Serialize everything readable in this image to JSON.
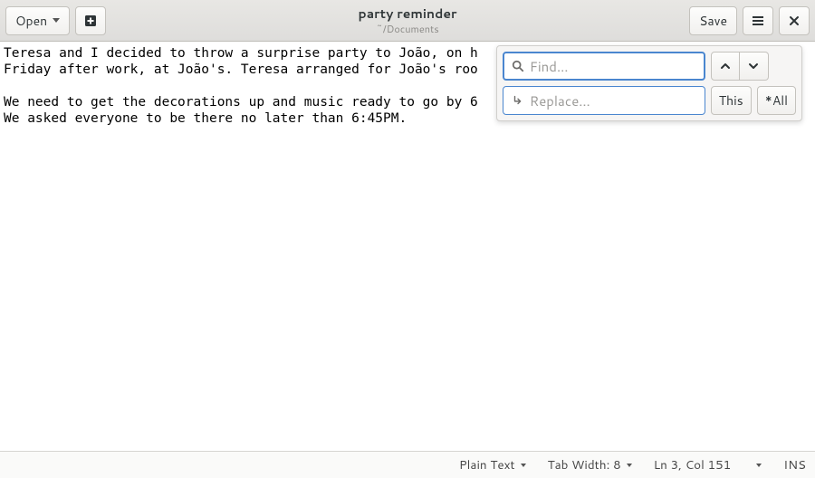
{
  "header": {
    "open_label": "Open",
    "save_label": "Save",
    "title": "party reminder",
    "subtitle": "~/Documents"
  },
  "document": {
    "text": "Teresa and I decided to throw a surprise party to João, on h\nFriday after work, at João's. Teresa arranged for João's roo\n\nWe need to get the decorations up and music ready to go by 6\nWe asked everyone to be there no later than 6:45PM."
  },
  "search": {
    "find_placeholder": "Find…",
    "replace_placeholder": "Replace…",
    "this_label": "This",
    "all_label": "*All"
  },
  "statusbar": {
    "language": "Plain Text",
    "tab_width": "Tab Width: 8",
    "cursor": "Ln 3, Col 151",
    "insert_mode": "INS"
  }
}
